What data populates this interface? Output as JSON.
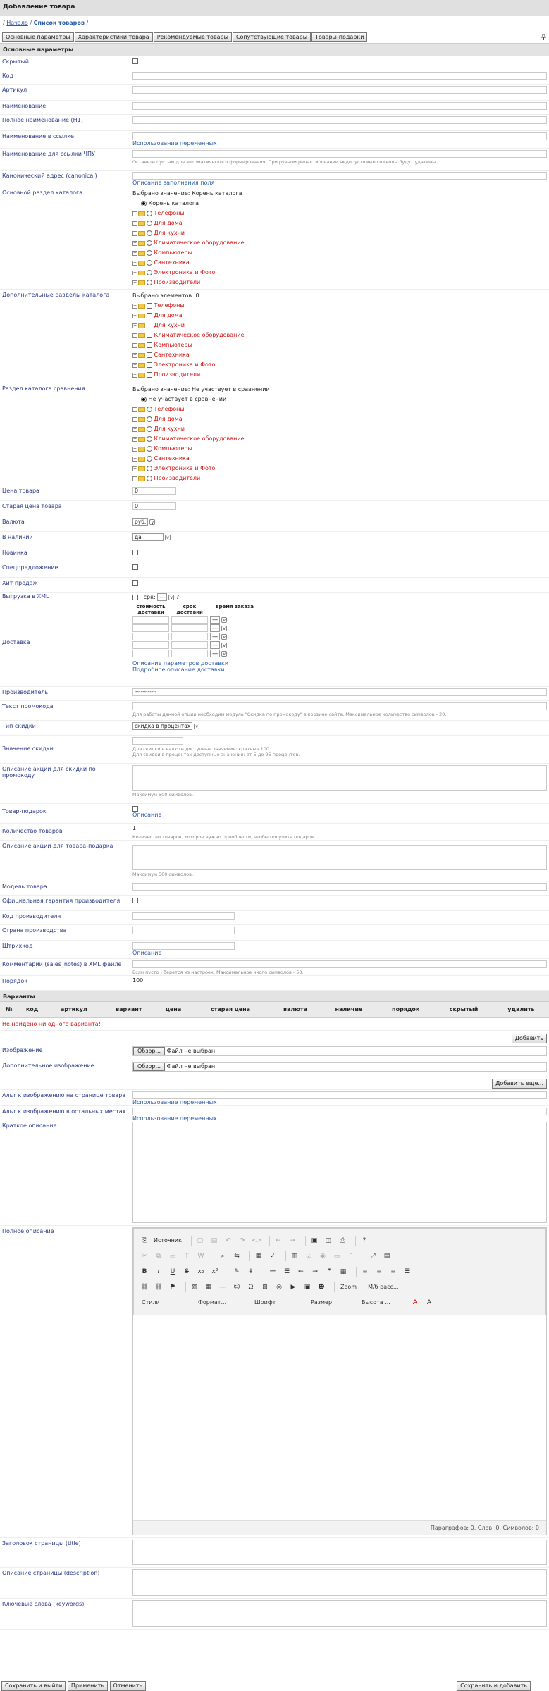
{
  "title": "Добавление товара",
  "breadcrumb": {
    "home": "Начало",
    "sep": "/",
    "current": "Список товаров"
  },
  "tabs": [
    "Основные параметры",
    "Характеристики товара",
    "Рекомендуемые товары",
    "Сопутствующие товары",
    "Товары-подарки"
  ],
  "sections": {
    "main": "Основные параметры",
    "variants": "Варианты"
  },
  "fields": {
    "hidden": "Скрытый",
    "code": "Код",
    "article": "Артикул",
    "name": "Наименование",
    "full_name": "Полное наименование (H1)",
    "link_name": "Наименование в ссылке",
    "link_vars": "Использование переменных",
    "chpu": "Наименование для ссылки ЧПУ",
    "chpu_hint": "Оставьте пустым для автоматического формирования. При ручном редактировании недопустимые символы будут удалены.",
    "canonical": "Канонический адрес (canonical)",
    "canonical_link": "Описание заполнения поля",
    "main_cat": "Основной раздел каталога",
    "main_cat_selected": "Выбрано значение: Корень каталога",
    "root": "Корень каталога",
    "extra_cat": "Дополнительные разделы каталога",
    "extra_cat_selected": "Выбрано элементов: 0",
    "cmp_cat": "Раздел каталога сравнения",
    "cmp_cat_selected": "Выбрано значение: Не участвует в сравнении",
    "cmp_none": "Не участвует в сравнении",
    "price": "Цена товара",
    "price_val": "0",
    "old_price": "Старая цена товара",
    "old_price_val": "0",
    "currency": "Валюта",
    "currency_val": "руб.",
    "stock": "В наличии",
    "stock_val": "да",
    "new": "Новинка",
    "special": "Спецпредложение",
    "hit": "Хит продаж",
    "xml": "Выгрузка в XML",
    "xml_srok": "срк:",
    "xml_sel": "---",
    "xml_q": "?",
    "delivery": "Доставка",
    "del_h1": "стоимость доставки",
    "del_h2": "срок доставки",
    "del_h3": "время заказа",
    "del_sel": "---",
    "del_link1": "Описание параметров доставки",
    "del_link2": "Подробное описание доставки",
    "maker": "Производитель",
    "maker_val": "------------",
    "promo": "Текст промокода",
    "promo_hint": "Для работы данной опции необходим модуль \"Скидка по промокоду\" в корзине сайта. Максимальное количество символов - 20.",
    "disc_type": "Тип скидки",
    "disc_type_val": "скидка в процентах",
    "disc_val": "Значение скидки",
    "disc_hint1": "Для скидки в валюте доступные значения: кратные 100.",
    "disc_hint2": "Для скидки в процентах доступные значения: от 5 до 95 процентов.",
    "promo_desc": "Описание акции для скидки по промокоду",
    "max500": "Максимум 500 символов.",
    "gift": "Товар-подарок",
    "gift_link": "Описание",
    "qty": "Количество товаров",
    "qty_val": "1",
    "qty_hint": "Количество товаров, которое нужно приобрести, чтобы получить подарок.",
    "gift_desc": "Описание акции для товара-подарка",
    "model": "Модель товара",
    "warranty": "Официальная гарантия производителя",
    "maker_code": "Код производителя",
    "country": "Страна производства",
    "barcode": "Штрихкод",
    "barcode_link": "Описание",
    "sales_notes": "Комментарий (sales_notes) в XML файле",
    "sales_hint": "Если пусто - берется из настроек. Максимальное число символов - 50.",
    "order": "Порядок",
    "order_val": "100"
  },
  "categories": [
    "Телефоны",
    "Для дома",
    "Для кухни",
    "Климатическое оборудование",
    "Компьютеры",
    "Сантехника",
    "Электроника и Фото",
    "Производители"
  ],
  "variants": {
    "columns": [
      "№",
      "код",
      "артикул",
      "вариант",
      "цена",
      "старая цена",
      "валюта",
      "наличие",
      "порядок",
      "скрытый",
      "удалить"
    ],
    "empty": "Не найдено ни одного варианта!",
    "add": "Добавить"
  },
  "images": {
    "image": "Изображение",
    "extra": "Дополнительное изображение",
    "browse": "Обзор...",
    "nofile": "Файл не выбран.",
    "add_more": "Добавить еще...",
    "alt_page": "Альт к изображению на странице товара",
    "alt_other": "Альт к изображению в остальных местах",
    "vars": "Использование переменных"
  },
  "short_desc": "Краткое описание",
  "full_desc": "Полное описание",
  "editor": {
    "source": "Источник",
    "zoom": "Zoom",
    "size_combo": "М/б расс...",
    "styles": "Стили",
    "format": "Формат...",
    "font": "Шрифт",
    "fsize": "Размер",
    "height": "Высота ...",
    "status": "Параграфов: 0, Слов: 0, Символов: 0"
  },
  "seo": {
    "title": "Заголовок страницы (title)",
    "desc": "Описание страницы (description)",
    "keywords": "Ключевые слова (keywords)"
  },
  "footer": {
    "save_exit": "Сохранить и выйти",
    "apply": "Применить",
    "cancel": "Отменить",
    "save_add": "Сохранить и добавить"
  }
}
